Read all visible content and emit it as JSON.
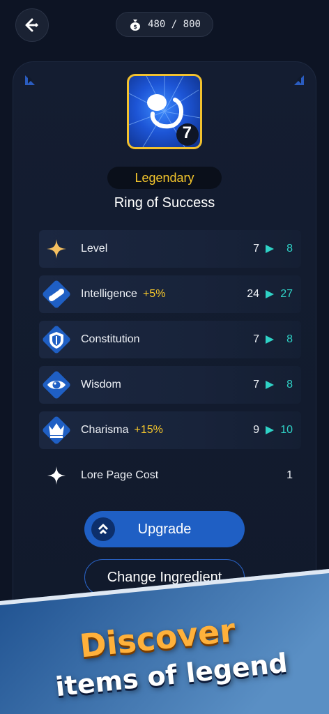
{
  "header": {
    "back_icon": "back-arrow-icon",
    "currency": {
      "icon": "money-bag-icon",
      "current": "480",
      "separator": "/",
      "max": "800",
      "display": "480 / 800"
    }
  },
  "item": {
    "icon": "ring-icon",
    "level_badge": "7",
    "rarity": "Legendary",
    "name": "Ring of Success",
    "colors": {
      "rarity": "#f6c72c",
      "frame": "#f2c12e",
      "increase": "#2fd2c6",
      "accent": "#1f5fc4"
    }
  },
  "stats": [
    {
      "icon": "sparkle-star-icon",
      "label": "Level",
      "bonus": "",
      "from": "7",
      "to": "8"
    },
    {
      "icon": "scroll-icon",
      "label": "Intelligence",
      "bonus": "+5%",
      "from": "24",
      "to": "27"
    },
    {
      "icon": "shield-icon",
      "label": "Constitution",
      "bonus": "",
      "from": "7",
      "to": "8"
    },
    {
      "icon": "eye-icon",
      "label": "Wisdom",
      "bonus": "",
      "from": "7",
      "to": "8"
    },
    {
      "icon": "crown-icon",
      "label": "Charisma",
      "bonus": "+15%",
      "from": "9",
      "to": "10"
    }
  ],
  "lore": {
    "icon": "white-sparkle-icon",
    "label": "Lore Page Cost",
    "value": "1"
  },
  "actions": {
    "upgrade_label": "Upgrade",
    "upgrade_icon": "double-chevron-up-icon",
    "change_label": "Change Ingredient"
  },
  "promo": {
    "title": "Discover",
    "subtitle": "items of legend"
  }
}
